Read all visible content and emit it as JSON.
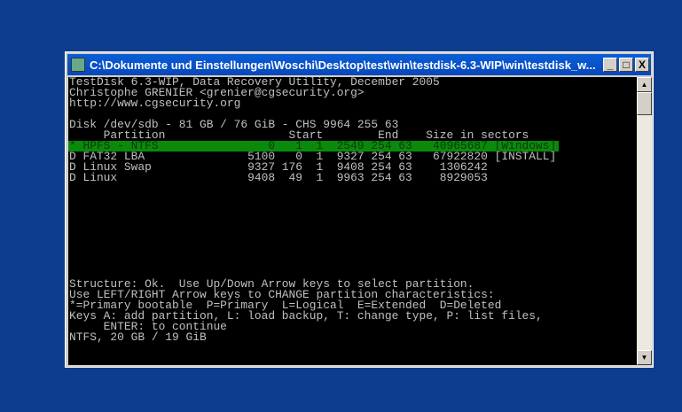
{
  "window": {
    "title": "C:\\Dokumente und Einstellungen\\Woschi\\Desktop\\test\\win\\testdisk-6.3-WIP\\win\\testdisk_w...",
    "minimize": "_",
    "maximize": "□",
    "close": "X"
  },
  "console": {
    "lines": [
      "TestDisk 6.3-WIP, Data Recovery Utility, December 2005",
      "Christophe GRENIER <grenier@cgsecurity.org>",
      "http://www.cgsecurity.org",
      "",
      "Disk /dev/sdb - 81 GB / 76 GiB - CHS 9964 255 63",
      "     Partition                  Start        End    Size in sectors",
      "* HPFS - NTFS                0   1  1  2549 254 63   40965687 [Windows]",
      "D FAT32 LBA               5100   0  1  9327 254 63   67922820 [INSTALL]",
      "D Linux Swap              9327 176  1  9408 254 63    1306242",
      "D Linux                   9408  49  1  9963 254 63    8929053",
      "",
      "",
      "",
      "",
      "",
      "",
      "",
      "",
      "",
      "Structure: Ok.  Use Up/Down Arrow keys to select partition.",
      "Use LEFT/RIGHT Arrow keys to CHANGE partition characteristics:",
      "*=Primary bootable  P=Primary  L=Logical  E=Extended  D=Deleted",
      "Keys A: add partition, L: load backup, T: change type, P: list files,",
      "     ENTER: to continue",
      "NTFS, 20 GB / 19 GiB"
    ],
    "selected_index": 6
  }
}
